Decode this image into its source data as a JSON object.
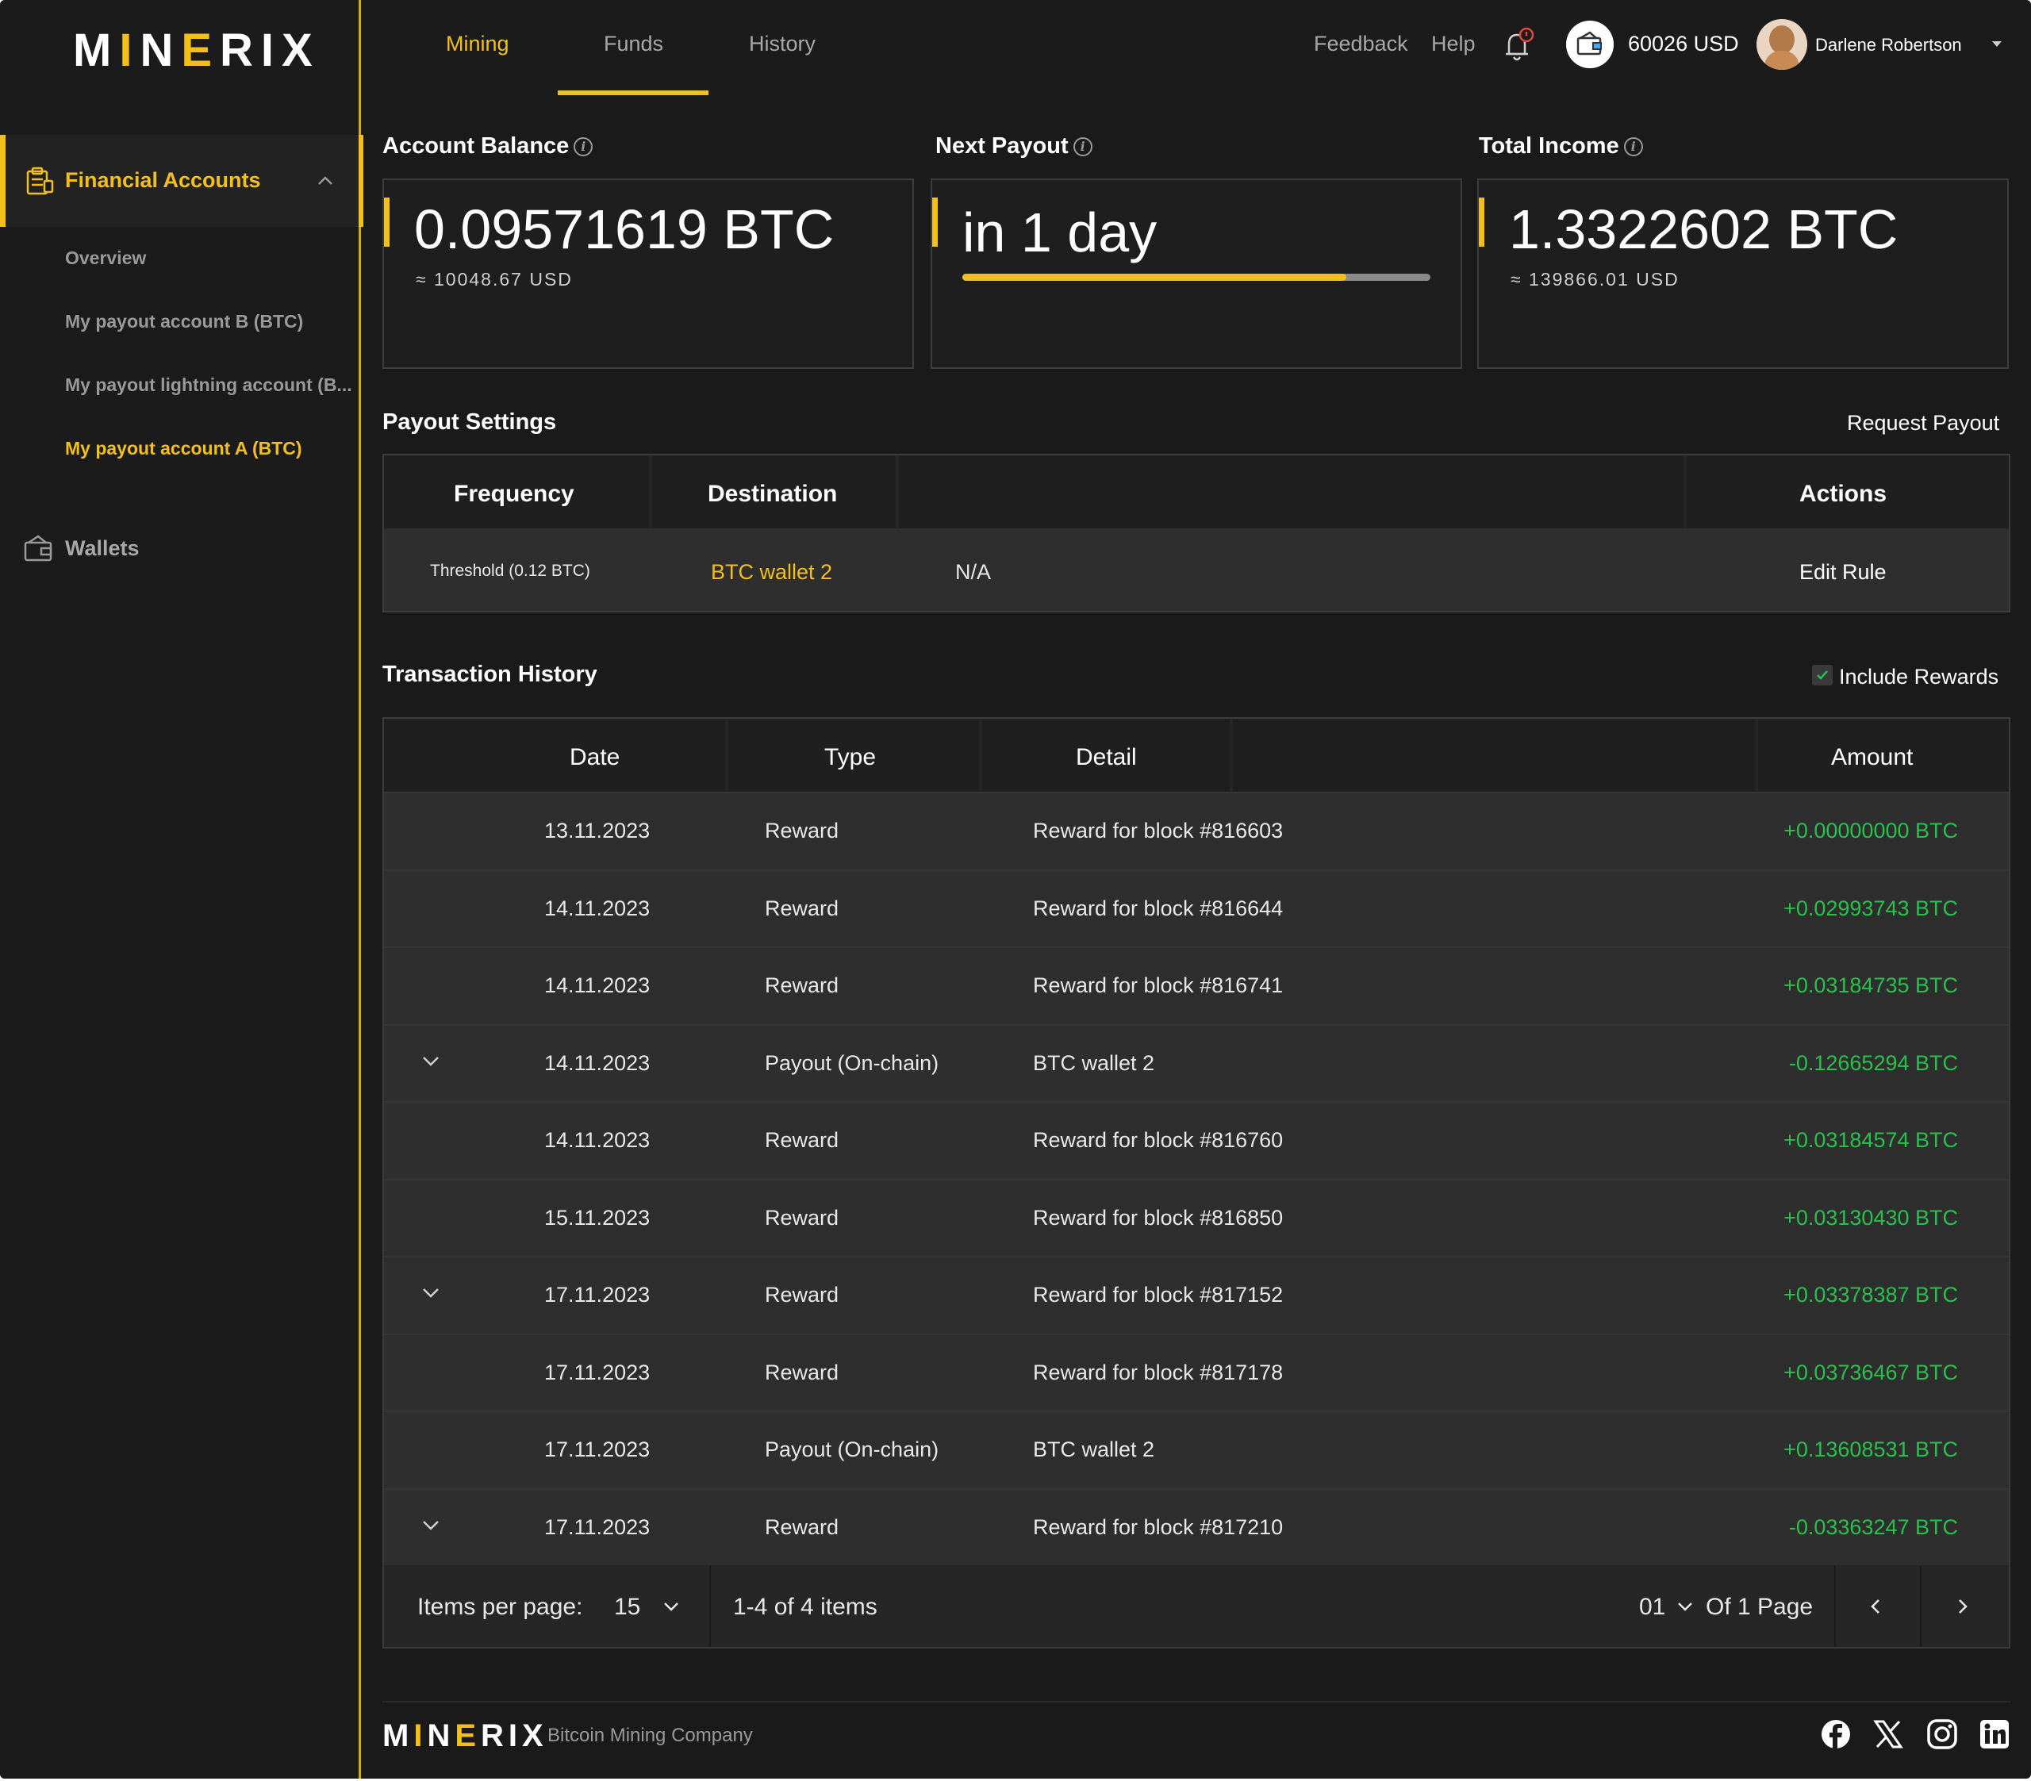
{
  "brand": {
    "logo_pre": "M",
    "logo_acc": "I",
    "logo_post": "N",
    "logo_acc2": "E",
    "logo_tail": "RIX",
    "tagline": "Bitcoin Mining Company"
  },
  "nav": {
    "tabs": [
      {
        "label": "Mining"
      },
      {
        "label": "Funds"
      },
      {
        "label": "History"
      }
    ],
    "feedback": "Feedback",
    "help": "Help",
    "balance": "60026 USD",
    "user_name": "Darlene Robertson"
  },
  "sidebar": {
    "section": "Financial Accounts",
    "items": [
      {
        "label": "Overview"
      },
      {
        "label": "My payout account B (BTC)"
      },
      {
        "label": "My payout lightning account (B..."
      },
      {
        "label": "My payout account A (BTC)"
      }
    ],
    "wallets": "Wallets"
  },
  "cards": {
    "balance": {
      "title": "Account Balance",
      "value": "0.09571619 BTC",
      "usd": "≈ 10048.67 USD"
    },
    "payout": {
      "title": "Next Payout",
      "value": "in 1 day",
      "progress": 0.82
    },
    "income": {
      "title": "Total Income",
      "value": "1.3322602 BTC",
      "usd": "≈ 139866.01 USD"
    }
  },
  "payout_settings": {
    "title": "Payout Settings",
    "request": "Request Payout",
    "headers": {
      "frequency": "Frequency",
      "destination": "Destination",
      "actions": "Actions"
    },
    "row": {
      "frequency": "Threshold (0.12 BTC)",
      "destination": "BTC wallet 2",
      "extra": "N/A",
      "action": "Edit Rule"
    }
  },
  "transactions": {
    "title": "Transaction History",
    "include_rewards": "Include Rewards",
    "headers": {
      "date": "Date",
      "type": "Type",
      "detail": "Detail",
      "amount": "Amount"
    },
    "rows": [
      {
        "date": "13.11.2023",
        "type": "Reward",
        "detail": "Reward for block #816603",
        "amount": "+0.00000000 BTC",
        "expand": false
      },
      {
        "date": "14.11.2023",
        "type": "Reward",
        "detail": "Reward for block #816644",
        "amount": "+0.02993743 BTC",
        "expand": false
      },
      {
        "date": "14.11.2023",
        "type": "Reward",
        "detail": "Reward for block #816741",
        "amount": "+0.03184735 BTC",
        "expand": false
      },
      {
        "date": "14.11.2023",
        "type": "Payout (On-chain)",
        "detail": "BTC wallet 2",
        "amount": "-0.12665294 BTC",
        "expand": true
      },
      {
        "date": "14.11.2023",
        "type": "Reward",
        "detail": "Reward for block #816760",
        "amount": "+0.03184574 BTC",
        "expand": false
      },
      {
        "date": "15.11.2023",
        "type": "Reward",
        "detail": "Reward for block #816850",
        "amount": "+0.03130430 BTC",
        "expand": false
      },
      {
        "date": "17.11.2023",
        "type": "Reward",
        "detail": "Reward for block #817152",
        "amount": "+0.03378387 BTC",
        "expand": true
      },
      {
        "date": "17.11.2023",
        "type": "Reward",
        "detail": "Reward for block #817178",
        "amount": "+0.03736467 BTC",
        "expand": false
      },
      {
        "date": "17.11.2023",
        "type": "Payout (On-chain)",
        "detail": "BTC wallet 2",
        "amount": "+0.13608531 BTC",
        "expand": false
      },
      {
        "date": "17.11.2023",
        "type": "Reward",
        "detail": "Reward for block #817210",
        "amount": "-0.03363247 BTC",
        "expand": true
      }
    ],
    "pager": {
      "items_label": "Items per page:",
      "per_page": "15",
      "range": "1-4 of 4 items",
      "page": "01",
      "of_pages": "Of 1 Page"
    }
  },
  "colors": {
    "accent": "#f3c01b",
    "positive": "#27c24c",
    "bg": "#1a1a1a"
  }
}
